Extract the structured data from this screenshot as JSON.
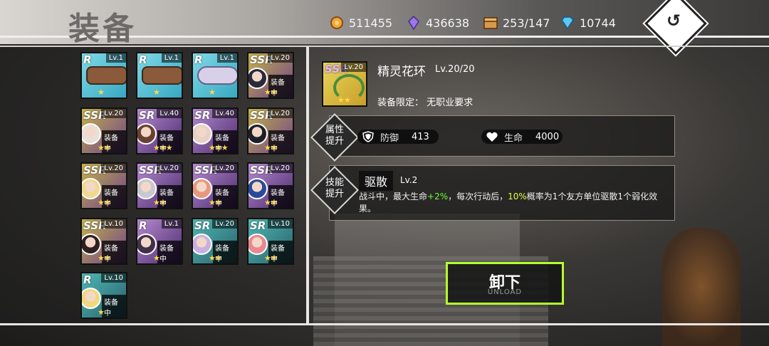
{
  "header": {
    "title": "装备",
    "resources": [
      {
        "icon": "coin-icon",
        "value": "511455"
      },
      {
        "icon": "purple-crystal-icon",
        "value": "436638"
      },
      {
        "icon": "treasure-chest-icon",
        "value": "253/147"
      },
      {
        "icon": "blue-diamond-icon",
        "value": "10744"
      }
    ],
    "back_icon": "↺"
  },
  "inventory": [
    {
      "rarity": "R",
      "level": "Lv.1",
      "stars": "★",
      "equipped": "",
      "style": "r",
      "art": "belt"
    },
    {
      "rarity": "R",
      "level": "Lv.1",
      "stars": "★",
      "equipped": "",
      "style": "r",
      "art": "belt"
    },
    {
      "rarity": "R",
      "level": "Lv.1",
      "stars": "★",
      "equipped": "",
      "style": "r",
      "art": "ribbon"
    },
    {
      "rarity": "SSR",
      "level": "Lv.20",
      "stars": "★★",
      "equipped": "装备中",
      "style": "ssr",
      "avatar": "#2a2a3a"
    },
    {
      "rarity": "SSR",
      "level": "Lv.20",
      "stars": "★★",
      "equipped": "装备中",
      "style": "ssr",
      "avatar": "#e8e0d8"
    },
    {
      "rarity": "SR",
      "level": "Lv.40",
      "stars": "★★★",
      "equipped": "装备中",
      "style": "ssr2",
      "avatar": "#6a4030"
    },
    {
      "rarity": "SR",
      "level": "Lv.40",
      "stars": "★★★",
      "equipped": "装备中",
      "style": "ssr2",
      "avatar": "#e8d0c8"
    },
    {
      "rarity": "SSR",
      "level": "Lv.20",
      "stars": "★★",
      "equipped": "装备中",
      "style": "ssr",
      "avatar": "#1e1e28"
    },
    {
      "rarity": "SSR",
      "level": "Lv.20",
      "stars": "★★",
      "equipped": "装备中",
      "style": "ssr",
      "avatar": "#f0d890"
    },
    {
      "rarity": "SSR",
      "level": "Lv.20",
      "stars": "★★",
      "equipped": "装备中",
      "style": "ssr2",
      "avatar": "#c8c8d0"
    },
    {
      "rarity": "SSR",
      "level": "Lv.20",
      "stars": "★★",
      "equipped": "装备中",
      "style": "ssr2",
      "avatar": "#e89880"
    },
    {
      "rarity": "SSR",
      "level": "Lv.20",
      "stars": "★★",
      "equipped": "装备中",
      "style": "ssr2",
      "avatar": "#2a4a9a"
    },
    {
      "rarity": "SSR",
      "level": "Lv.10",
      "stars": "★★",
      "equipped": "装备中",
      "style": "ssr",
      "avatar": "#302020"
    },
    {
      "rarity": "R",
      "level": "Lv.1",
      "stars": "★",
      "equipped": "装备中",
      "style": "ssr2",
      "avatar": "#403048"
    },
    {
      "rarity": "SR",
      "level": "Lv.20",
      "stars": "★★",
      "equipped": "装备中",
      "style": "ssr3",
      "avatar": "#c8b0e0"
    },
    {
      "rarity": "SR",
      "level": "Lv.10",
      "stars": "★★",
      "equipped": "装备中",
      "style": "ssr3",
      "avatar": "#e88890"
    },
    {
      "rarity": "R",
      "level": "Lv.10",
      "stars": "★",
      "equipped": "装备中",
      "style": "ssr3",
      "avatar": "#f0d880"
    }
  ],
  "detail": {
    "rarity": "SSR",
    "icon_level": "Lv.20",
    "stars": "★★",
    "name": "精灵花环",
    "level": "Lv.20/20",
    "limit": "装备限定：  无职业要求",
    "attr_label_1": "属性",
    "attr_label_2": "提升",
    "stats": [
      {
        "icon": "shield-icon",
        "label": "防御",
        "value": "413"
      },
      {
        "icon": "heart-icon",
        "label": "生命",
        "value": "4000"
      }
    ],
    "skill_label_1": "技能",
    "skill_label_2": "提升",
    "skill_name": "驱散",
    "skill_level": "Lv.2",
    "skill_desc_1": "战斗中，最大生命",
    "skill_desc_hp": "+2%",
    "skill_desc_2": "，每次行动后，",
    "skill_desc_pct": "10%",
    "skill_desc_3": "概率为1个友方单位驱散1个弱化效果。"
  },
  "unload_button": {
    "label": "卸下",
    "sublabel": "UNLOAD"
  }
}
